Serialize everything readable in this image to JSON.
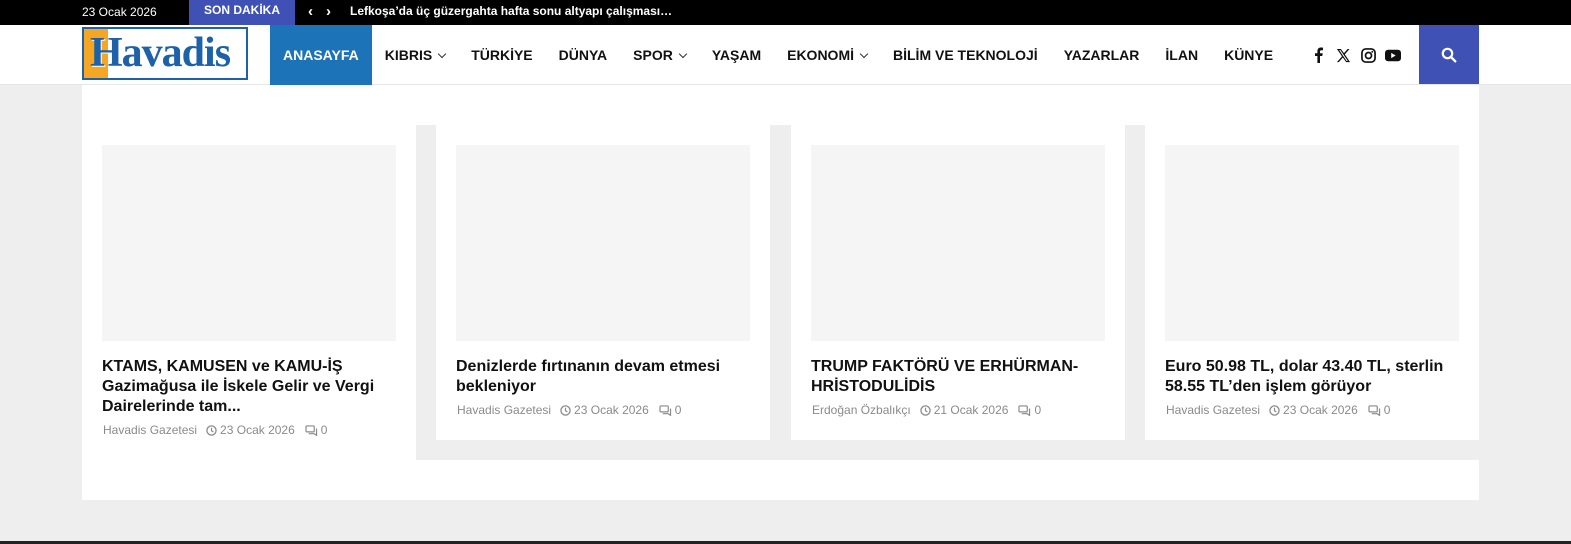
{
  "topbar": {
    "date": "23 Ocak 2026",
    "breaking_label": "SON DAKİKA",
    "ticker_text": "Lefkoşa’da üç güzergahta hafta sonu altyapı çalışması…"
  },
  "header": {
    "logo_text": "Havadis",
    "nav": [
      {
        "label": "ANASAYFA",
        "active": true
      },
      {
        "label": "KIBRIS",
        "dropdown": true
      },
      {
        "label": "TÜRKİYE"
      },
      {
        "label": "DÜNYA"
      },
      {
        "label": "SPOR",
        "dropdown": true
      },
      {
        "label": "YAŞAM"
      },
      {
        "label": "EKONOMİ",
        "dropdown": true
      },
      {
        "label": "BİLİM VE TEKNOLOJİ"
      },
      {
        "label": "YAZARLAR"
      },
      {
        "label": "İLAN"
      },
      {
        "label": "KÜNYE"
      }
    ],
    "social_icons": [
      "facebook-icon",
      "x-twitter-icon",
      "instagram-icon",
      "youtube-icon"
    ],
    "colors": {
      "accent_blue": "#1d73b8",
      "search_blue": "#3f51b5",
      "logo_orange": "#f5a623"
    }
  },
  "articles": [
    {
      "title": "KTAMS, KAMUSEN ve KAMU-İŞ Gazimağusa ile İskele Gelir ve Vergi Dairelerinde tam...",
      "author": "Havadis Gazetesi",
      "date": "23 Ocak 2026",
      "comments": "0"
    },
    {
      "title": "Denizlerde fırtınanın devam etmesi bekleniyor",
      "author": "Havadis Gazetesi",
      "date": "23 Ocak 2026",
      "comments": "0"
    },
    {
      "title": "TRUMP FAKTÖRÜ VE ERHÜRMAN-HRİSTODULİDİS",
      "author": "Erdoğan Özbalıkçı",
      "date": "21 Ocak 2026",
      "comments": "0"
    },
    {
      "title": "Euro 50.98 TL, dolar 43.40 TL, sterlin 58.55 TL’den işlem görüyor",
      "author": "Havadis Gazetesi",
      "date": "23 Ocak 2026",
      "comments": "0"
    }
  ]
}
